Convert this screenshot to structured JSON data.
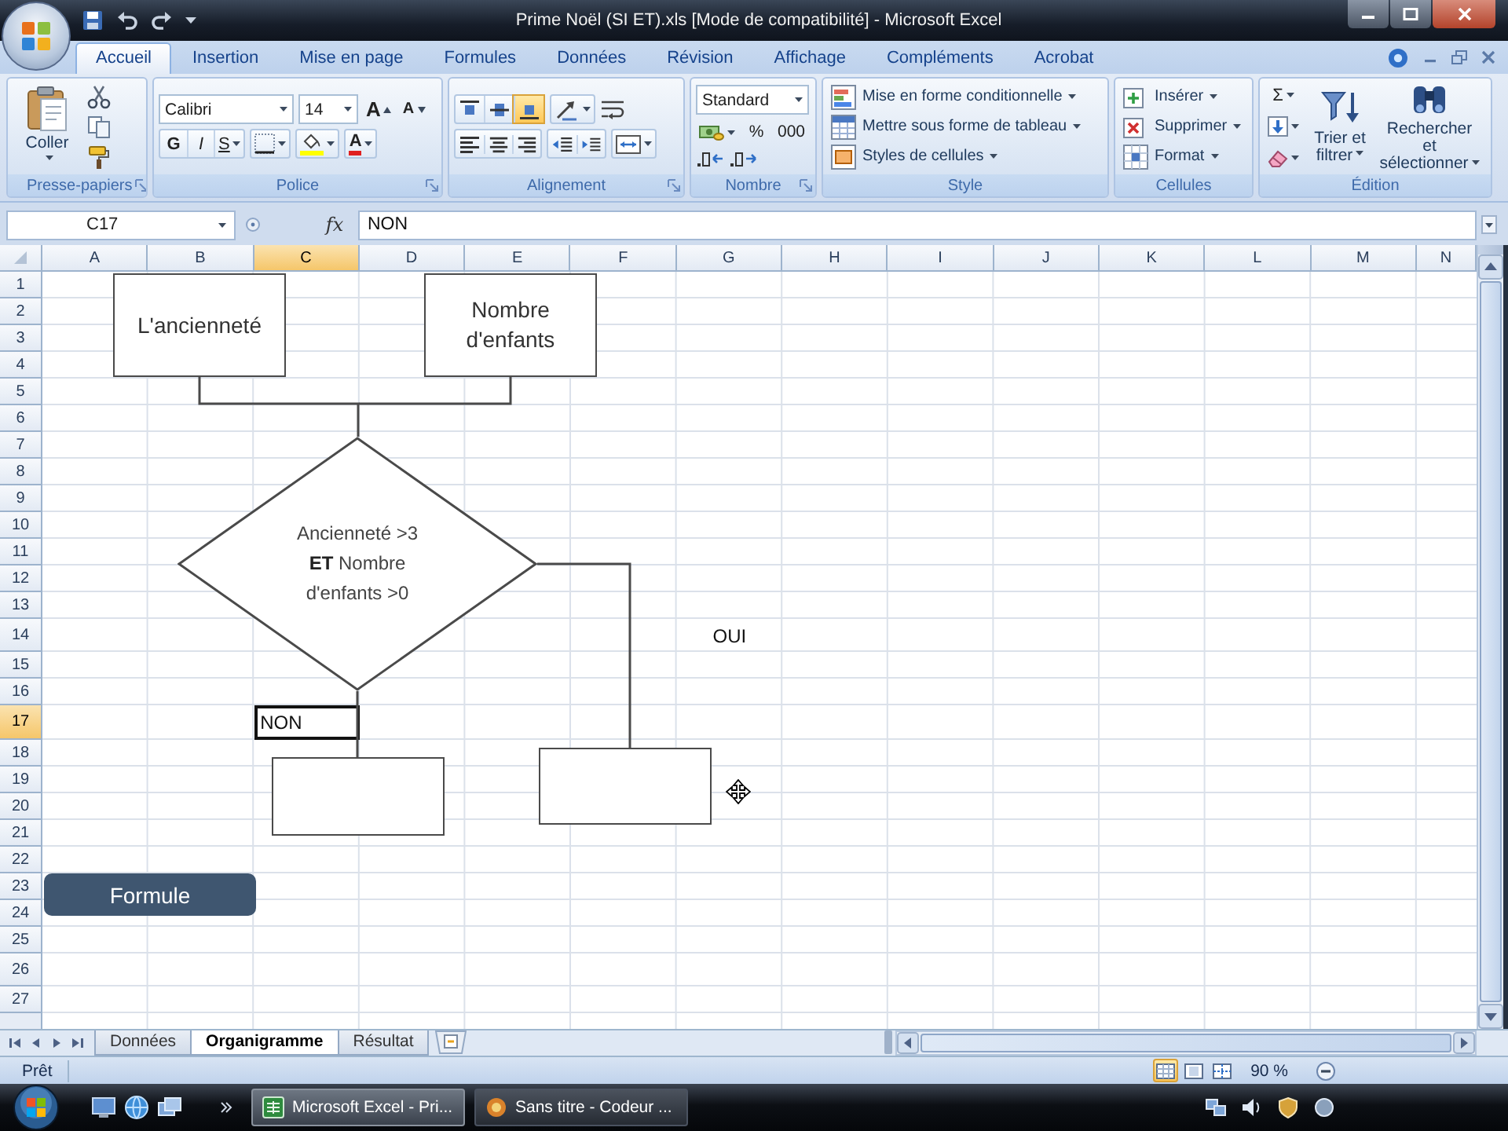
{
  "window": {
    "title": "Prime Noël (SI ET).xls [Mode de compatibilité] - Microsoft Excel"
  },
  "ribbon": {
    "tabs": [
      {
        "label": "Accueil",
        "selected": true
      },
      {
        "label": "Insertion",
        "selected": false
      },
      {
        "label": "Mise en page",
        "selected": false
      },
      {
        "label": "Formules",
        "selected": false
      },
      {
        "label": "Données",
        "selected": false
      },
      {
        "label": "Révision",
        "selected": false
      },
      {
        "label": "Affichage",
        "selected": false
      },
      {
        "label": "Compléments",
        "selected": false
      },
      {
        "label": "Acrobat",
        "selected": false
      }
    ],
    "clipboard": {
      "label": "Presse-papiers",
      "paste": "Coller"
    },
    "font": {
      "label": "Police",
      "font_name": "Calibri",
      "font_size": "14",
      "grow": "A",
      "shrink": "A",
      "styles": [
        {
          "kind": "bold",
          "label": "G"
        },
        {
          "kind": "italic",
          "label": "I"
        },
        {
          "kind": "underline",
          "label": "S"
        }
      ],
      "font_color": "A"
    },
    "alignment": {
      "label": "Alignement",
      "vertical": [
        {
          "kind": "top",
          "selected": false
        },
        {
          "kind": "middle",
          "selected": false
        },
        {
          "kind": "bottom",
          "selected": true
        }
      ]
    },
    "number": {
      "label": "Nombre",
      "format": "Standard",
      "buttons": [
        "%",
        "000"
      ]
    },
    "style": {
      "label": "Style",
      "commands": [
        "Mise en forme conditionnelle",
        "Mettre sous forme de tableau",
        "Styles de cellules"
      ]
    },
    "cells": {
      "label": "Cellules",
      "commands": [
        "Insérer",
        "Supprimer",
        "Format"
      ]
    },
    "editing": {
      "label": "Édition",
      "autosum": "Σ",
      "commands": [
        "Trier et filtrer",
        "Rechercher et sélectionner"
      ]
    }
  },
  "formula_bar": {
    "name_box": "C17",
    "function_button": "fx",
    "formula": "NON"
  },
  "sheet": {
    "columns": [
      {
        "label": "A",
        "selected": false
      },
      {
        "label": "B",
        "selected": false
      },
      {
        "label": "C",
        "selected": true
      },
      {
        "label": "D",
        "selected": false
      },
      {
        "label": "E",
        "selected": false
      },
      {
        "label": "F",
        "selected": false
      },
      {
        "label": "G",
        "selected": false
      },
      {
        "label": "H",
        "selected": false
      },
      {
        "label": "I",
        "selected": false
      },
      {
        "label": "J",
        "selected": false
      },
      {
        "label": "K",
        "selected": false
      },
      {
        "label": "L",
        "selected": false
      },
      {
        "label": "M",
        "selected": false
      },
      {
        "label": "N",
        "selected": false
      }
    ],
    "rows": [
      {
        "label": "1",
        "selected": false
      },
      {
        "label": "2",
        "selected": false
      },
      {
        "label": "3",
        "selected": false
      },
      {
        "label": "4",
        "selected": false
      },
      {
        "label": "5",
        "selected": false
      },
      {
        "label": "6",
        "selected": false
      },
      {
        "label": "7",
        "selected": false
      },
      {
        "label": "8",
        "selected": false
      },
      {
        "label": "9",
        "selected": false
      },
      {
        "label": "10",
        "selected": false
      },
      {
        "label": "11",
        "selected": false
      },
      {
        "label": "12",
        "selected": false
      },
      {
        "label": "13",
        "selected": false
      },
      {
        "label": "14",
        "selected": false
      },
      {
        "label": "15",
        "selected": false
      },
      {
        "label": "16",
        "selected": false
      },
      {
        "label": "17",
        "selected": true
      },
      {
        "label": "18",
        "selected": false
      },
      {
        "label": "19",
        "selected": false
      },
      {
        "label": "20",
        "selected": false
      },
      {
        "label": "21",
        "selected": false
      },
      {
        "label": "22",
        "selected": false
      },
      {
        "label": "23",
        "selected": false
      },
      {
        "label": "24",
        "selected": false
      },
      {
        "label": "25",
        "selected": false
      },
      {
        "label": "26",
        "selected": false
      },
      {
        "label": "27",
        "selected": false
      }
    ],
    "cells": [
      {
        "value": "NON",
        "selected": true
      },
      {
        "value": "OUI",
        "selected": false
      }
    ],
    "flowchart": {
      "shapes": [
        {
          "kind": "process",
          "text": "L'ancienneté"
        },
        {
          "kind": "process",
          "text": "Nombre d'enfants"
        },
        {
          "kind": "decision",
          "text": "Ancienneté >3\n**ET** Nombre\nd'enfants >0"
        },
        {
          "kind": "process"
        },
        {
          "kind": "process"
        },
        {
          "kind": "button",
          "text": "Formule"
        }
      ]
    }
  },
  "sheet_tabs": [
    {
      "label": "Données",
      "selected": false
    },
    {
      "label": "Organigramme",
      "selected": true
    },
    {
      "label": "Résultat",
      "selected": false
    }
  ],
  "status_bar": {
    "status": "Prêt",
    "views": [
      {
        "kind": "normal",
        "selected": true
      },
      {
        "kind": "page_layout",
        "selected": false
      },
      {
        "kind": "page_break",
        "selected": false
      }
    ],
    "zoom": "90 %"
  },
  "taskbar": {
    "tasks": [
      {
        "label": "Microsoft Excel - Pri...",
        "selected": true
      },
      {
        "label": "Sans titre - Codeur ...",
        "selected": false
      }
    ]
  }
}
